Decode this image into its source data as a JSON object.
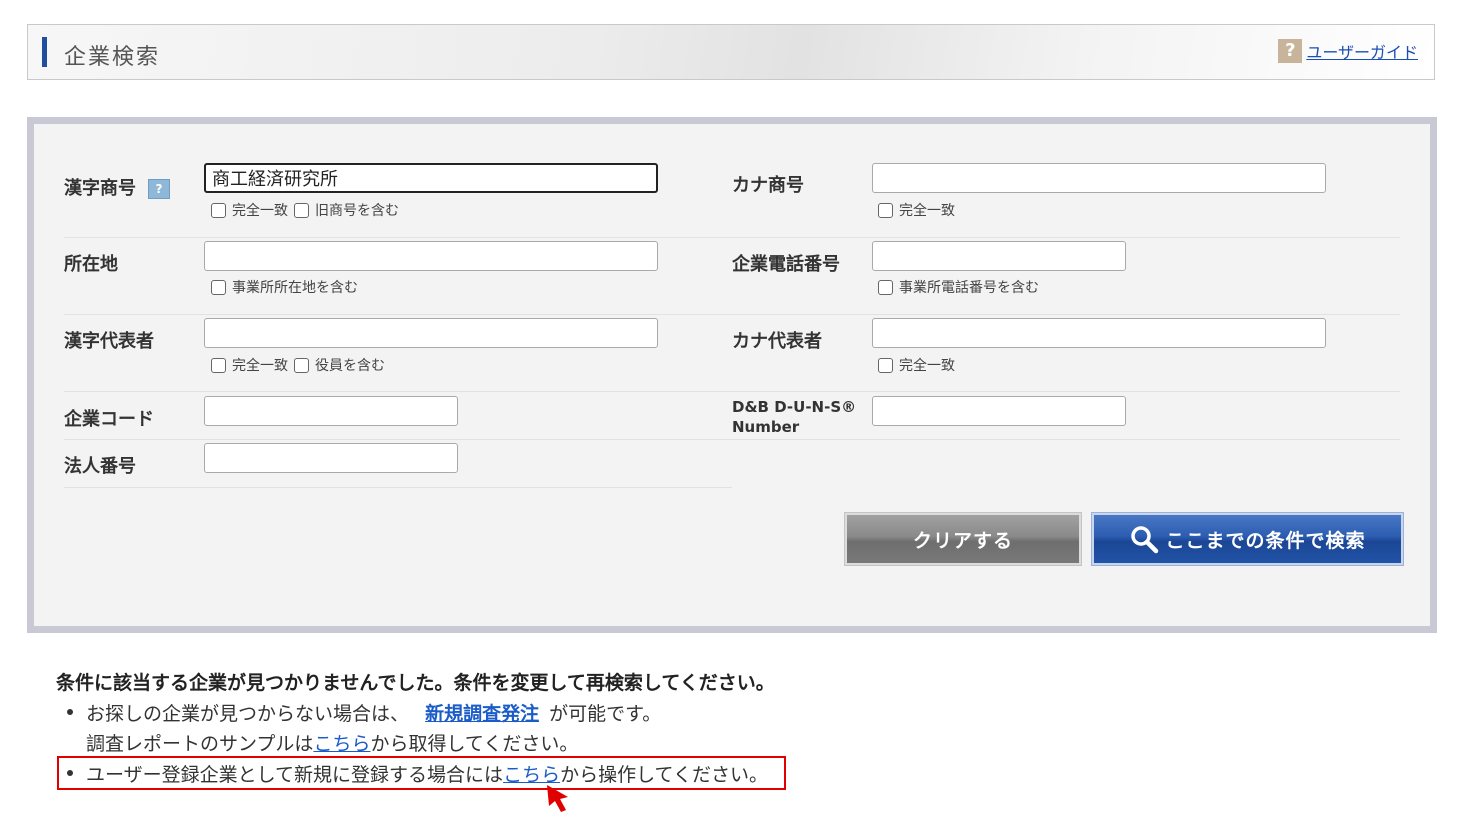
{
  "header": {
    "title": "企業検索",
    "guide_icon": "?",
    "guide_link": "ユーザーガイド"
  },
  "form": {
    "kanji_name": {
      "label": "漢字商号",
      "help": "?",
      "value": "商工経済研究所",
      "checks": [
        "完全一致",
        "旧商号を含む"
      ]
    },
    "kana_name": {
      "label": "カナ商号",
      "value": "",
      "checks": [
        "完全一致"
      ]
    },
    "address": {
      "label": "所在地",
      "value": "",
      "checks": [
        "事業所所在地を含む"
      ]
    },
    "phone": {
      "label": "企業電話番号",
      "value": "",
      "checks": [
        "事業所電話番号を含む"
      ]
    },
    "kanji_rep": {
      "label": "漢字代表者",
      "value": "",
      "checks": [
        "完全一致",
        "役員を含む"
      ]
    },
    "kana_rep": {
      "label": "カナ代表者",
      "value": "",
      "checks": [
        "完全一致"
      ]
    },
    "company_code": {
      "label": "企業コード",
      "value": ""
    },
    "duns": {
      "label_line1": "D&B D-U-N-S®",
      "label_line2": "Number",
      "value": ""
    },
    "corp_number": {
      "label": "法人番号",
      "value": ""
    }
  },
  "buttons": {
    "clear": "クリアする",
    "search": "ここまでの条件で検索"
  },
  "messages": {
    "title": "条件に該当する企業が見つかりませんでした。条件を変更して再検索してください。",
    "line1_pre": "お探しの企業が見つからない場合は、",
    "line1_link": "新規調査発注",
    "line1_post": "が可能です。",
    "line2_pre": "調査レポートのサンプルは",
    "line2_link": "こちら",
    "line2_post": "から取得してください。",
    "line3_pre": "ユーザー登録企業として新規に登録する場合には",
    "line3_link": "こちら",
    "line3_post": "から操作してください。"
  },
  "colors": {
    "highlight": "#e00000",
    "link": "#1b5cc8",
    "header_bar": "#1f4e9e"
  }
}
